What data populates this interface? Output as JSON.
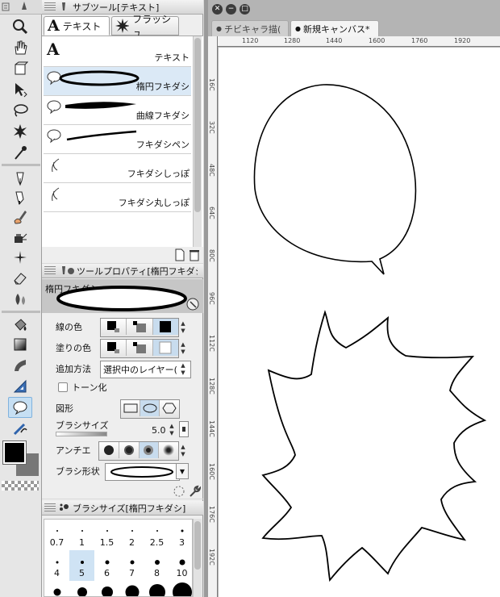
{
  "subtool_panel": {
    "title": "サブツール[テキスト]",
    "tabs": [
      {
        "label": "テキスト",
        "icon": "text-A-icon",
        "active": true
      },
      {
        "label": "フラッシュ",
        "icon": "flash-burst-icon",
        "active": false
      }
    ],
    "items": [
      {
        "label": "テキスト",
        "icon": "text-A-icon",
        "selected": false
      },
      {
        "label": "楕円フキダシ",
        "icon": "ellipse-balloon-icon",
        "selected": true
      },
      {
        "label": "曲線フキダシ",
        "icon": "curve-balloon-icon",
        "selected": false
      },
      {
        "label": "フキダシペン",
        "icon": "balloon-pen-icon",
        "selected": false
      },
      {
        "label": "フキダシしっぽ",
        "icon": "balloon-tail-icon",
        "selected": false
      },
      {
        "label": "フキダシ丸しっぽ",
        "icon": "balloon-round-tail-icon",
        "selected": false
      }
    ]
  },
  "tool_property_panel": {
    "title": "ツールプロパティ[楕円フキダシ",
    "preview_label": "楕円フキダシ",
    "rows": {
      "line_color": "線の色",
      "fill_color": "塗りの色",
      "add_method": "追加方法",
      "add_method_value": "選択中のレイヤー(",
      "tone": "トーン化",
      "shape": "図形",
      "brush_size": "ブラシサイズ",
      "brush_size_value": "5.0",
      "antialias": "アンチエ",
      "brush_shape": "ブラシ形状"
    }
  },
  "brush_size_panel": {
    "title": "ブラシサイズ[楕円フキダシ]",
    "sizes": [
      "0.7",
      "1",
      "1.5",
      "2",
      "2.5",
      "3",
      "4",
      "5",
      "6",
      "7",
      "8",
      "10"
    ],
    "selected": "5"
  },
  "document_tabs": [
    {
      "label": "チビキャラ描(",
      "active": false
    },
    {
      "label": "新規キャンバス*",
      "active": true
    }
  ],
  "ruler": {
    "horizontal": [
      "1120",
      "1280",
      "1440",
      "1600",
      "1760",
      "1920"
    ],
    "vertical": [
      "16C",
      "32C",
      "48C",
      "64C",
      "80C",
      "96C",
      "112C",
      "128C",
      "144C",
      "160C",
      "176C",
      "192C"
    ]
  },
  "colors": {
    "accent": "#7fb2de",
    "selection": "#dbe9f6",
    "main_color": "#000000",
    "sub_color": "#777777"
  }
}
